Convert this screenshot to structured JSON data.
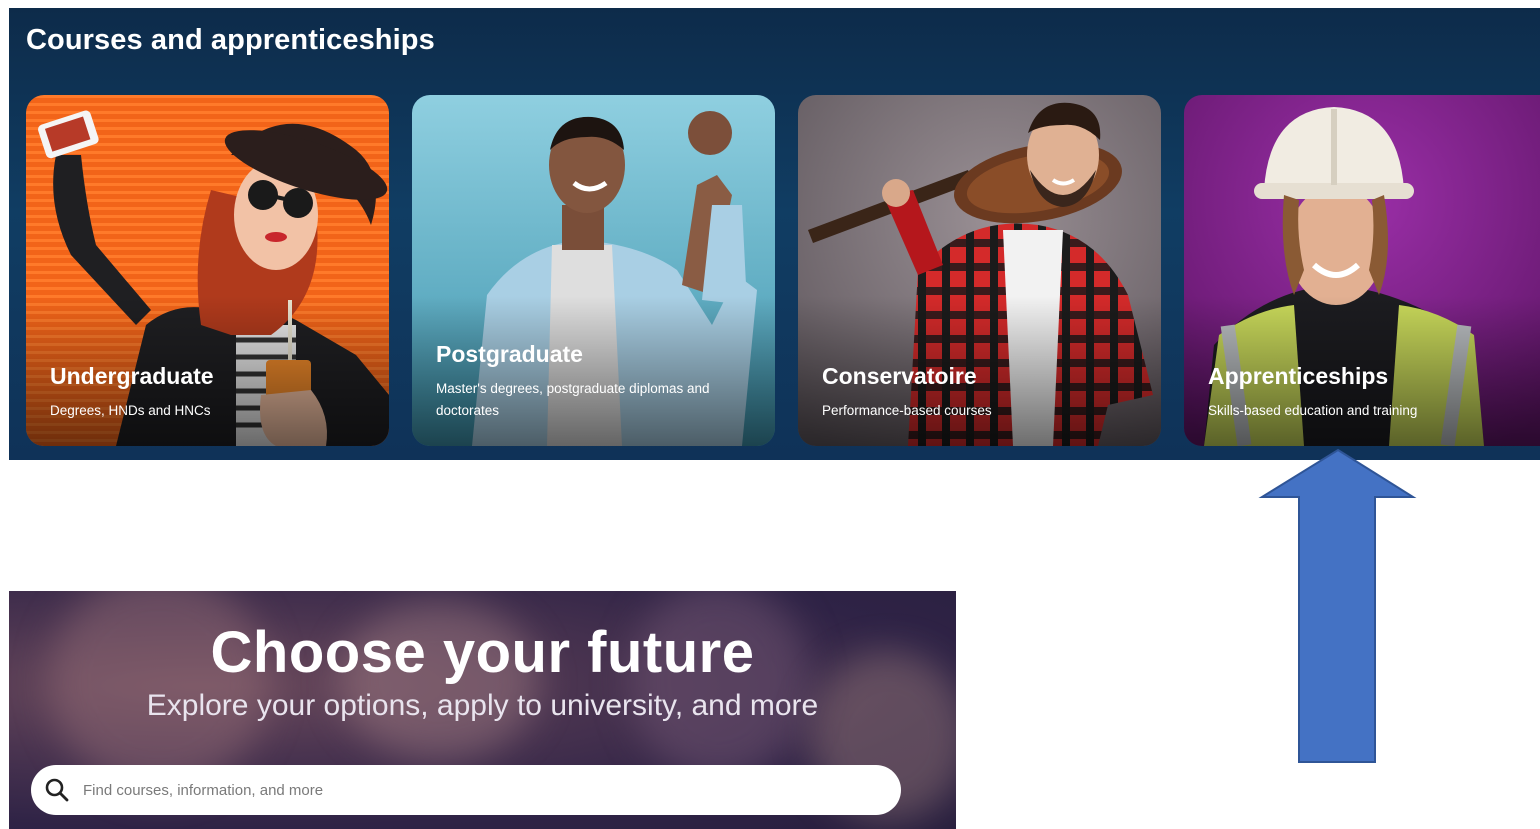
{
  "banner": {
    "title": "Courses and apprenticeships",
    "cards": [
      {
        "title": "Undergraduate",
        "subtitle": "Degrees, HNDs and HNCs",
        "color": "#f05a16"
      },
      {
        "title": "Postgraduate",
        "subtitle": "Master's degrees, postgraduate diplomas and doctorates",
        "color": "#5cb1c8"
      },
      {
        "title": "Conservatoire",
        "subtitle": "Performance-based courses",
        "color": "#7b7479"
      },
      {
        "title": "Apprenticeships",
        "subtitle": "Skills-based education and training",
        "color": "#7a1f85"
      }
    ]
  },
  "annotation": {
    "arrow_color": "#4472c4",
    "arrow_target": "Apprenticeships"
  },
  "hero": {
    "title": "Choose your future",
    "subtitle": "Explore your options, apply to university, and more",
    "search": {
      "placeholder": "Find courses, information, and more",
      "value": "",
      "icon": "search-icon"
    }
  }
}
